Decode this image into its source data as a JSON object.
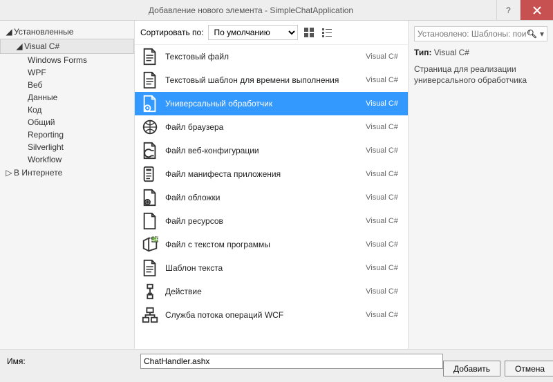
{
  "window": {
    "title": "Добавление нового элемента - SimpleChatApplication"
  },
  "left": {
    "installed": "Установленные",
    "vcsharp": "Visual C#",
    "items": [
      "Windows Forms",
      "WPF",
      "Веб",
      "Данные",
      "Код",
      "Общий",
      "Reporting",
      "Silverlight",
      "Workflow"
    ],
    "online": "В Интернете"
  },
  "toolbar": {
    "sort_label": "Сортировать по:",
    "sort_value": "По умолчанию"
  },
  "templates": [
    {
      "label": "Текстовый файл",
      "lang": "Visual C#",
      "icon": "file-text"
    },
    {
      "label": "Текстовый шаблон для времени выполнения",
      "lang": "Visual C#",
      "icon": "file-text"
    },
    {
      "label": "Универсальный обработчик",
      "lang": "Visual C#",
      "icon": "handler",
      "selected": true
    },
    {
      "label": "Файл браузера",
      "lang": "Visual C#",
      "icon": "globe"
    },
    {
      "label": "Файл веб-конфигурации",
      "lang": "Visual C#",
      "icon": "config"
    },
    {
      "label": "Файл манифеста приложения",
      "lang": "Visual C#",
      "icon": "manifest"
    },
    {
      "label": "Файл обложки",
      "lang": "Visual C#",
      "icon": "skin"
    },
    {
      "label": "Файл ресурсов",
      "lang": "Visual C#",
      "icon": "file"
    },
    {
      "label": "Файл с текстом программы",
      "lang": "Visual C#",
      "icon": "code"
    },
    {
      "label": "Шаблон текста",
      "lang": "Visual C#",
      "icon": "file-text"
    },
    {
      "label": "Действие",
      "lang": "Visual C#",
      "icon": "activity"
    },
    {
      "label": "Служба потока операций WCF",
      "lang": "Visual C#",
      "icon": "wcf"
    }
  ],
  "right": {
    "search_placeholder": "Установлено: Шаблоны: поиск",
    "type_label": "Тип:",
    "type_value": "Visual C#",
    "description": "Страница для реализации универсального обработчика"
  },
  "bottom": {
    "name_label": "Имя:",
    "name_value": "ChatHandler.ashx",
    "add": "Добавить",
    "cancel": "Отмена"
  }
}
